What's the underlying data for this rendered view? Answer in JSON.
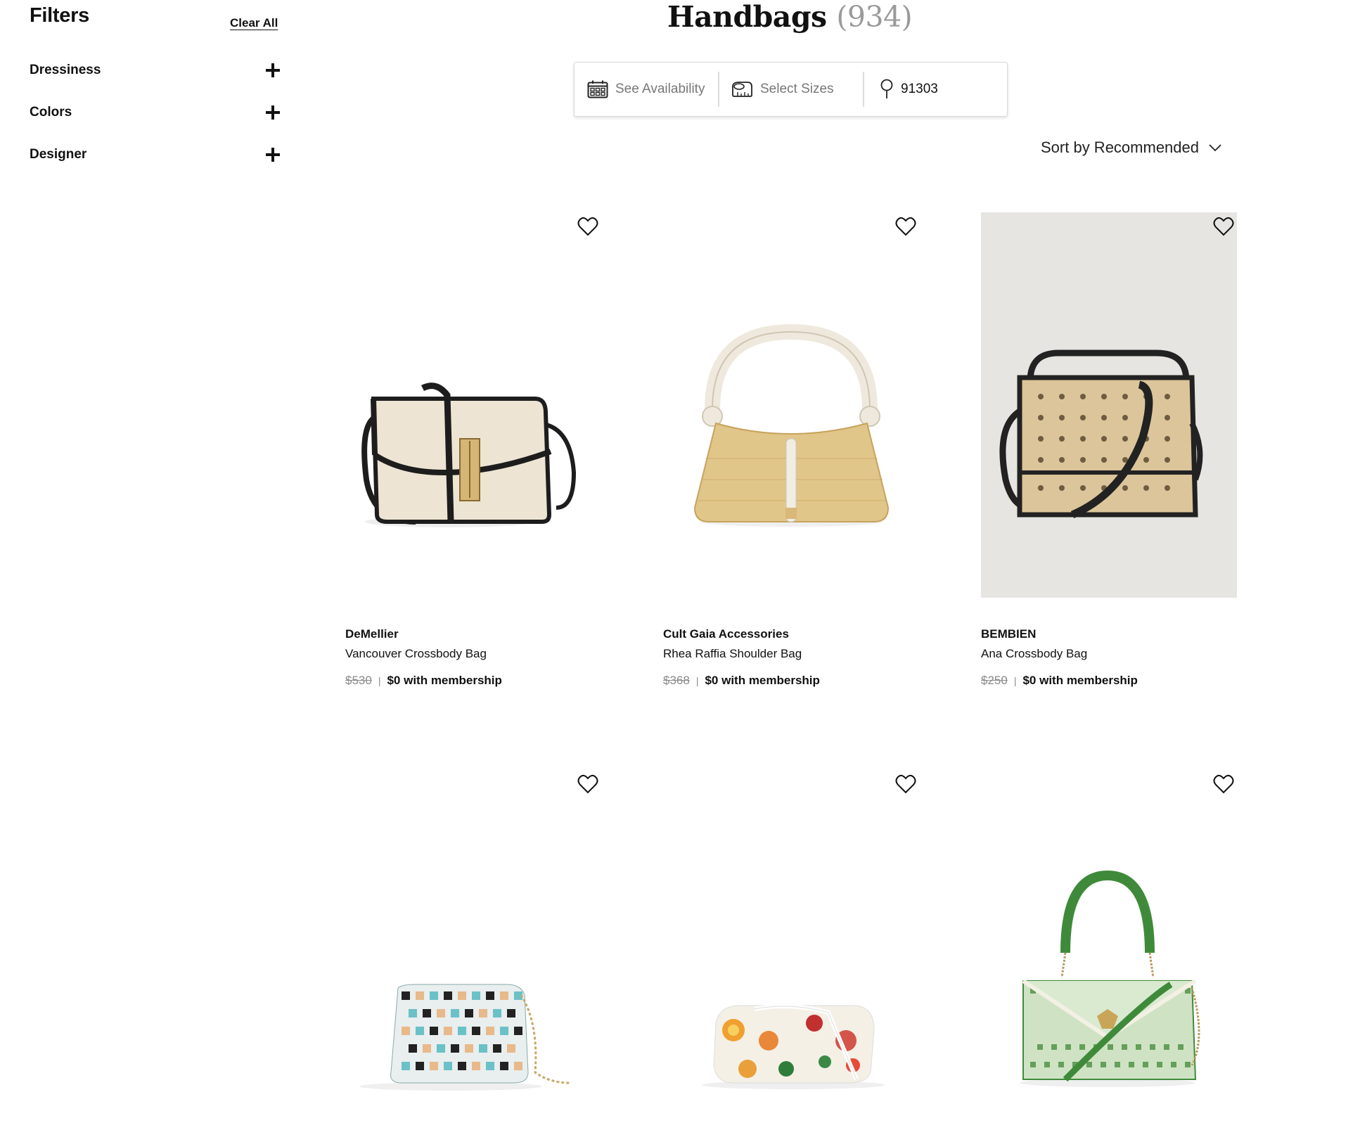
{
  "sidebar": {
    "title": "Filters",
    "clear_all": "Clear All",
    "filters": [
      {
        "label": "Dressiness"
      },
      {
        "label": "Colors"
      },
      {
        "label": "Designer"
      }
    ]
  },
  "header": {
    "title": "Handbags",
    "count": "(934)"
  },
  "availability": {
    "dates": "See Availability",
    "sizes": "Select Sizes",
    "zip": "91303"
  },
  "sort": {
    "label": "Sort by Recommended"
  },
  "products": [
    {
      "brand": "DeMellier",
      "name": "Vancouver Crossbody Bag",
      "old_price": "$530",
      "sep": "|",
      "member_price": "$0 with membership"
    },
    {
      "brand": "Cult Gaia Accessories",
      "name": "Rhea Raffia Shoulder Bag",
      "old_price": "$368",
      "sep": "|",
      "member_price": "$0 with membership"
    },
    {
      "brand": "BEMBIEN",
      "name": "Ana Crossbody Bag",
      "old_price": "$250",
      "sep": "|",
      "member_price": "$0 with membership"
    },
    {
      "brand": "",
      "name": "",
      "old_price": "",
      "sep": "",
      "member_price": ""
    },
    {
      "brand": "",
      "name": "",
      "old_price": "",
      "sep": "",
      "member_price": ""
    },
    {
      "brand": "",
      "name": "",
      "old_price": "",
      "sep": "",
      "member_price": ""
    }
  ],
  "colors": {
    "text": "#111111",
    "muted": "#8a8a8a",
    "border": "#d8d8d8"
  }
}
